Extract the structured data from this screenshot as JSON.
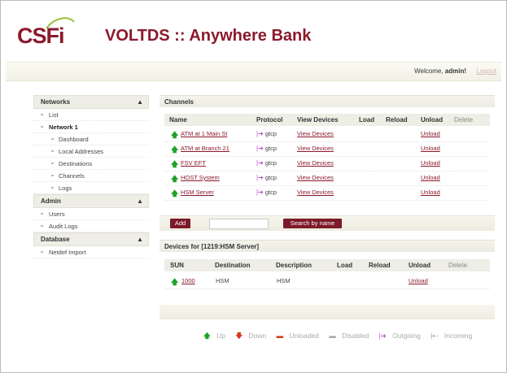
{
  "brand": {
    "logo_text": "CSFi",
    "app_title": "VOLTDS :: Anywhere Bank"
  },
  "topbar": {
    "welcome_prefix": "Welcome, ",
    "username": "admin!",
    "logout": "Logout"
  },
  "sidebar": {
    "networks": {
      "title": "Networks",
      "chev": "▲"
    },
    "network_items": [
      {
        "label": "List"
      },
      {
        "label": "Network 1"
      },
      {
        "label": "Dashboard"
      },
      {
        "label": "Local Addresses"
      },
      {
        "label": "Destinations"
      },
      {
        "label": "Channels"
      },
      {
        "label": "Logs"
      }
    ],
    "admin": {
      "title": "Admin",
      "chev": "▲"
    },
    "admin_items": [
      {
        "label": "Users"
      },
      {
        "label": "Audit Logs"
      }
    ],
    "database": {
      "title": "Database",
      "chev": "▲"
    },
    "database_items": [
      {
        "label": "Netdef Import"
      }
    ]
  },
  "channels": {
    "title": "Channels",
    "columns": {
      "name": "Name",
      "protocol": "Protocol",
      "view": "View Devices",
      "load": "Load",
      "reload": "Reload",
      "unload": "Unload",
      "delete": "Delete"
    },
    "rows": [
      {
        "name": "ATM at 1 Main St",
        "protocol": "gtcp",
        "view": "View Devices",
        "unload": "Unload"
      },
      {
        "name": "ATM at Branch 21",
        "protocol": "gtcp",
        "view": "View Devices",
        "unload": "Unload"
      },
      {
        "name": "FSV EFT",
        "protocol": "gtcp",
        "view": "View Devices",
        "unload": "Unload"
      },
      {
        "name": "HOST System",
        "protocol": "gtcp",
        "view": "View Devices",
        "unload": "Unload"
      },
      {
        "name": "HSM Server",
        "protocol": "gtcp",
        "view": "View Devices",
        "unload": "Unload"
      }
    ],
    "add_button": "Add",
    "search_value": "",
    "search_button": "Search by name"
  },
  "devices": {
    "title": "Devices for [1219:HSM Server]",
    "columns": {
      "sun": "SUN",
      "destination": "Destination",
      "description": "Description",
      "load": "Load",
      "reload": "Reload",
      "unload": "Unload",
      "delete": "Delete"
    },
    "rows": [
      {
        "sun": "1000",
        "destination": "HSM",
        "description": "HSM",
        "unload": "Unload"
      }
    ]
  },
  "legend": {
    "up": "Up",
    "down": "Down",
    "unloaded": "Unloaded",
    "disabled": "Disabled",
    "outgoing": "Outgoing",
    "incoming": "Incoming"
  },
  "colors": {
    "brand": "#8b1a2b",
    "up": "#22a02a",
    "down": "#d23a1a",
    "outgoing": "#b04ec0",
    "incoming": "#6aa0c8"
  }
}
